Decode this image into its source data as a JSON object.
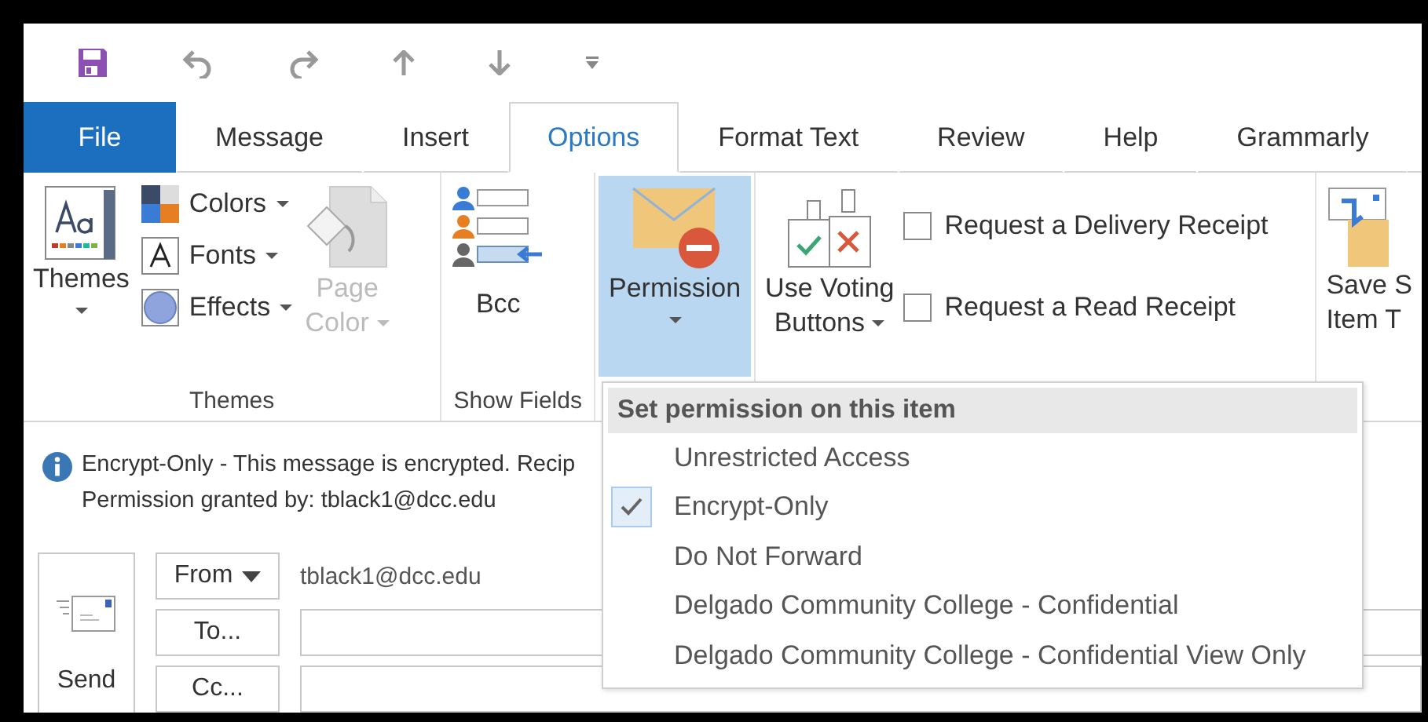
{
  "tabs": [
    {
      "label": "File",
      "kind": "file",
      "selected": false
    },
    {
      "label": "Message",
      "kind": "tab",
      "selected": false
    },
    {
      "label": "Insert",
      "kind": "tab",
      "selected": false
    },
    {
      "label": "Options",
      "kind": "tab",
      "selected": true
    },
    {
      "label": "Format Text",
      "kind": "tab",
      "selected": false
    },
    {
      "label": "Review",
      "kind": "tab",
      "selected": false
    },
    {
      "label": "Help",
      "kind": "tab",
      "selected": false
    },
    {
      "label": "Grammarly",
      "kind": "tab",
      "selected": false
    }
  ],
  "ribbon": {
    "themes_group": {
      "label": "Themes",
      "themes_button": "Themes",
      "small_buttons": [
        {
          "label": "Colors",
          "kind": "colors"
        },
        {
          "label": "Fonts",
          "kind": "fonts"
        },
        {
          "label": "Effects",
          "kind": "effects"
        }
      ],
      "page_color": {
        "line_1": "Page",
        "line_2": "Color",
        "disabled": true
      }
    },
    "show_fields_group": {
      "label": "Show Fields",
      "bcc_button": "Bcc"
    },
    "permission_button": {
      "label": "Permission",
      "pressed": true
    },
    "tracking_group": {
      "voting_line_1": "Use Voting",
      "voting_line_2": "Buttons",
      "checkboxes": [
        {
          "label": "Request a Delivery Receipt",
          "checked": false
        },
        {
          "label": "Request a Read Receipt",
          "checked": false
        }
      ]
    },
    "save_sent": {
      "line_1": "Save S",
      "line_2": "Item T"
    }
  },
  "info_bar": {
    "line_1": "Encrypt-Only - This message is encrypted. Recip",
    "line_2": "Permission granted by: tblack1@dcc.edu"
  },
  "form": {
    "send_button": "Send",
    "from_button": "From",
    "from_value": "tblack1@dcc.edu",
    "to_button": "To...",
    "cc_button": "Cc..."
  },
  "permission_menu": {
    "header": "Set permission on this item",
    "items": [
      {
        "label": "Unrestricted Access",
        "checked": false
      },
      {
        "label": "Encrypt-Only",
        "checked": true
      },
      {
        "label": "Do Not Forward",
        "checked": false
      },
      {
        "label": "Delgado Community College - Confidential",
        "checked": false
      },
      {
        "label": "Delgado Community College - Confidential View Only",
        "checked": false
      }
    ]
  }
}
